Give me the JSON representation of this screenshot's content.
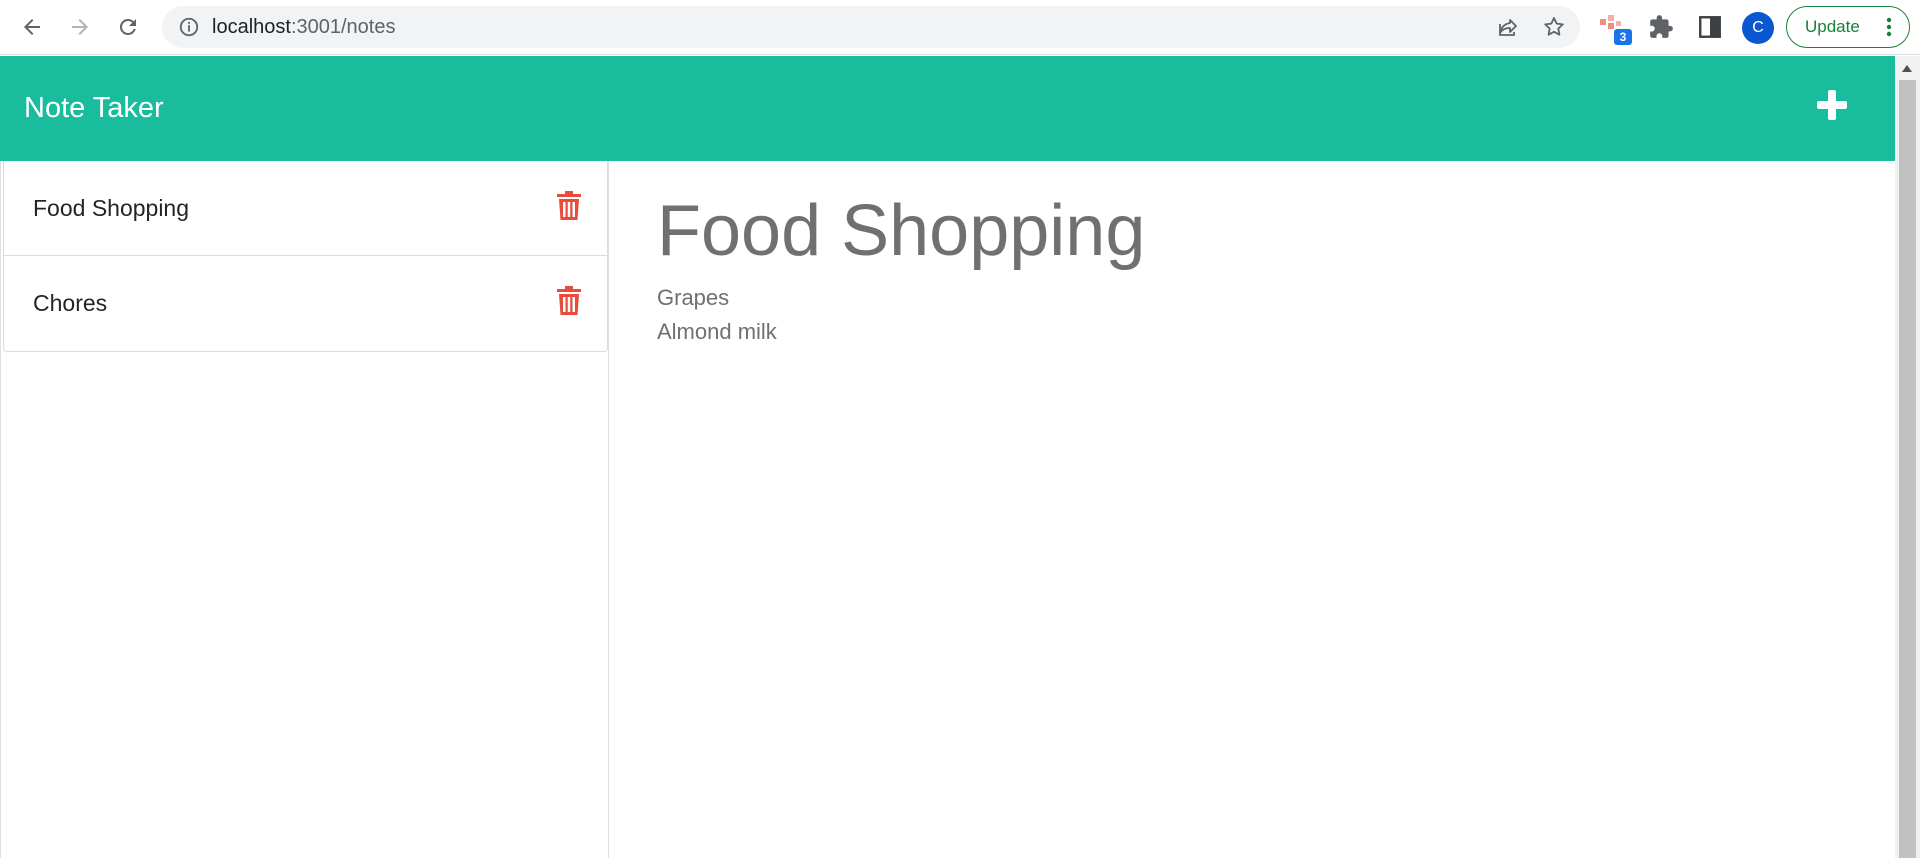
{
  "browser": {
    "url_host": "localhost",
    "url_path": ":3001/notes",
    "extension_badge": "3",
    "avatar_letter": "C",
    "update_label": "Update",
    "icons": [
      "back-arrow-icon",
      "forward-arrow-icon",
      "reload-icon",
      "info-icon",
      "share-icon",
      "star-icon",
      "extension-icon",
      "puzzle-icon",
      "side-panel-icon",
      "more-vert-icon"
    ]
  },
  "app": {
    "brand": "Note Taker",
    "accent_color": "#19bc9c",
    "delete_color": "#e74c3c",
    "add_icon": "plus-icon",
    "delete_icon": "trash-icon"
  },
  "notes": [
    {
      "title": "Food Shopping"
    },
    {
      "title": "Chores"
    }
  ],
  "active_note": {
    "title": "Food Shopping",
    "body": "Grapes\nAlmond milk"
  }
}
